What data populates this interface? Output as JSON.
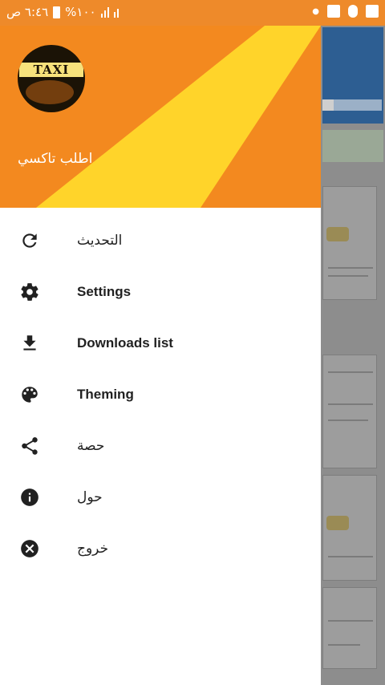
{
  "status_bar": {
    "time": "٦:٤٦ ص",
    "battery": "%١٠٠",
    "colors": {
      "bg": "#ee8a2a"
    }
  },
  "drawer": {
    "header": {
      "username": "اطلب تاكسي",
      "avatar_text": "TAXI",
      "colors": {
        "yellow": "#ffd42a",
        "orange": "#f3891f"
      }
    },
    "menu": [
      {
        "icon": "refresh-icon",
        "label": "التحديث"
      },
      {
        "icon": "gear-icon",
        "label": "Settings"
      },
      {
        "icon": "download-icon",
        "label": "Downloads list"
      },
      {
        "icon": "palette-icon",
        "label": "Theming"
      },
      {
        "icon": "share-icon",
        "label": "حصة"
      },
      {
        "icon": "info-icon",
        "label": "حول"
      },
      {
        "icon": "close-circle-icon",
        "label": "خروج"
      }
    ]
  }
}
